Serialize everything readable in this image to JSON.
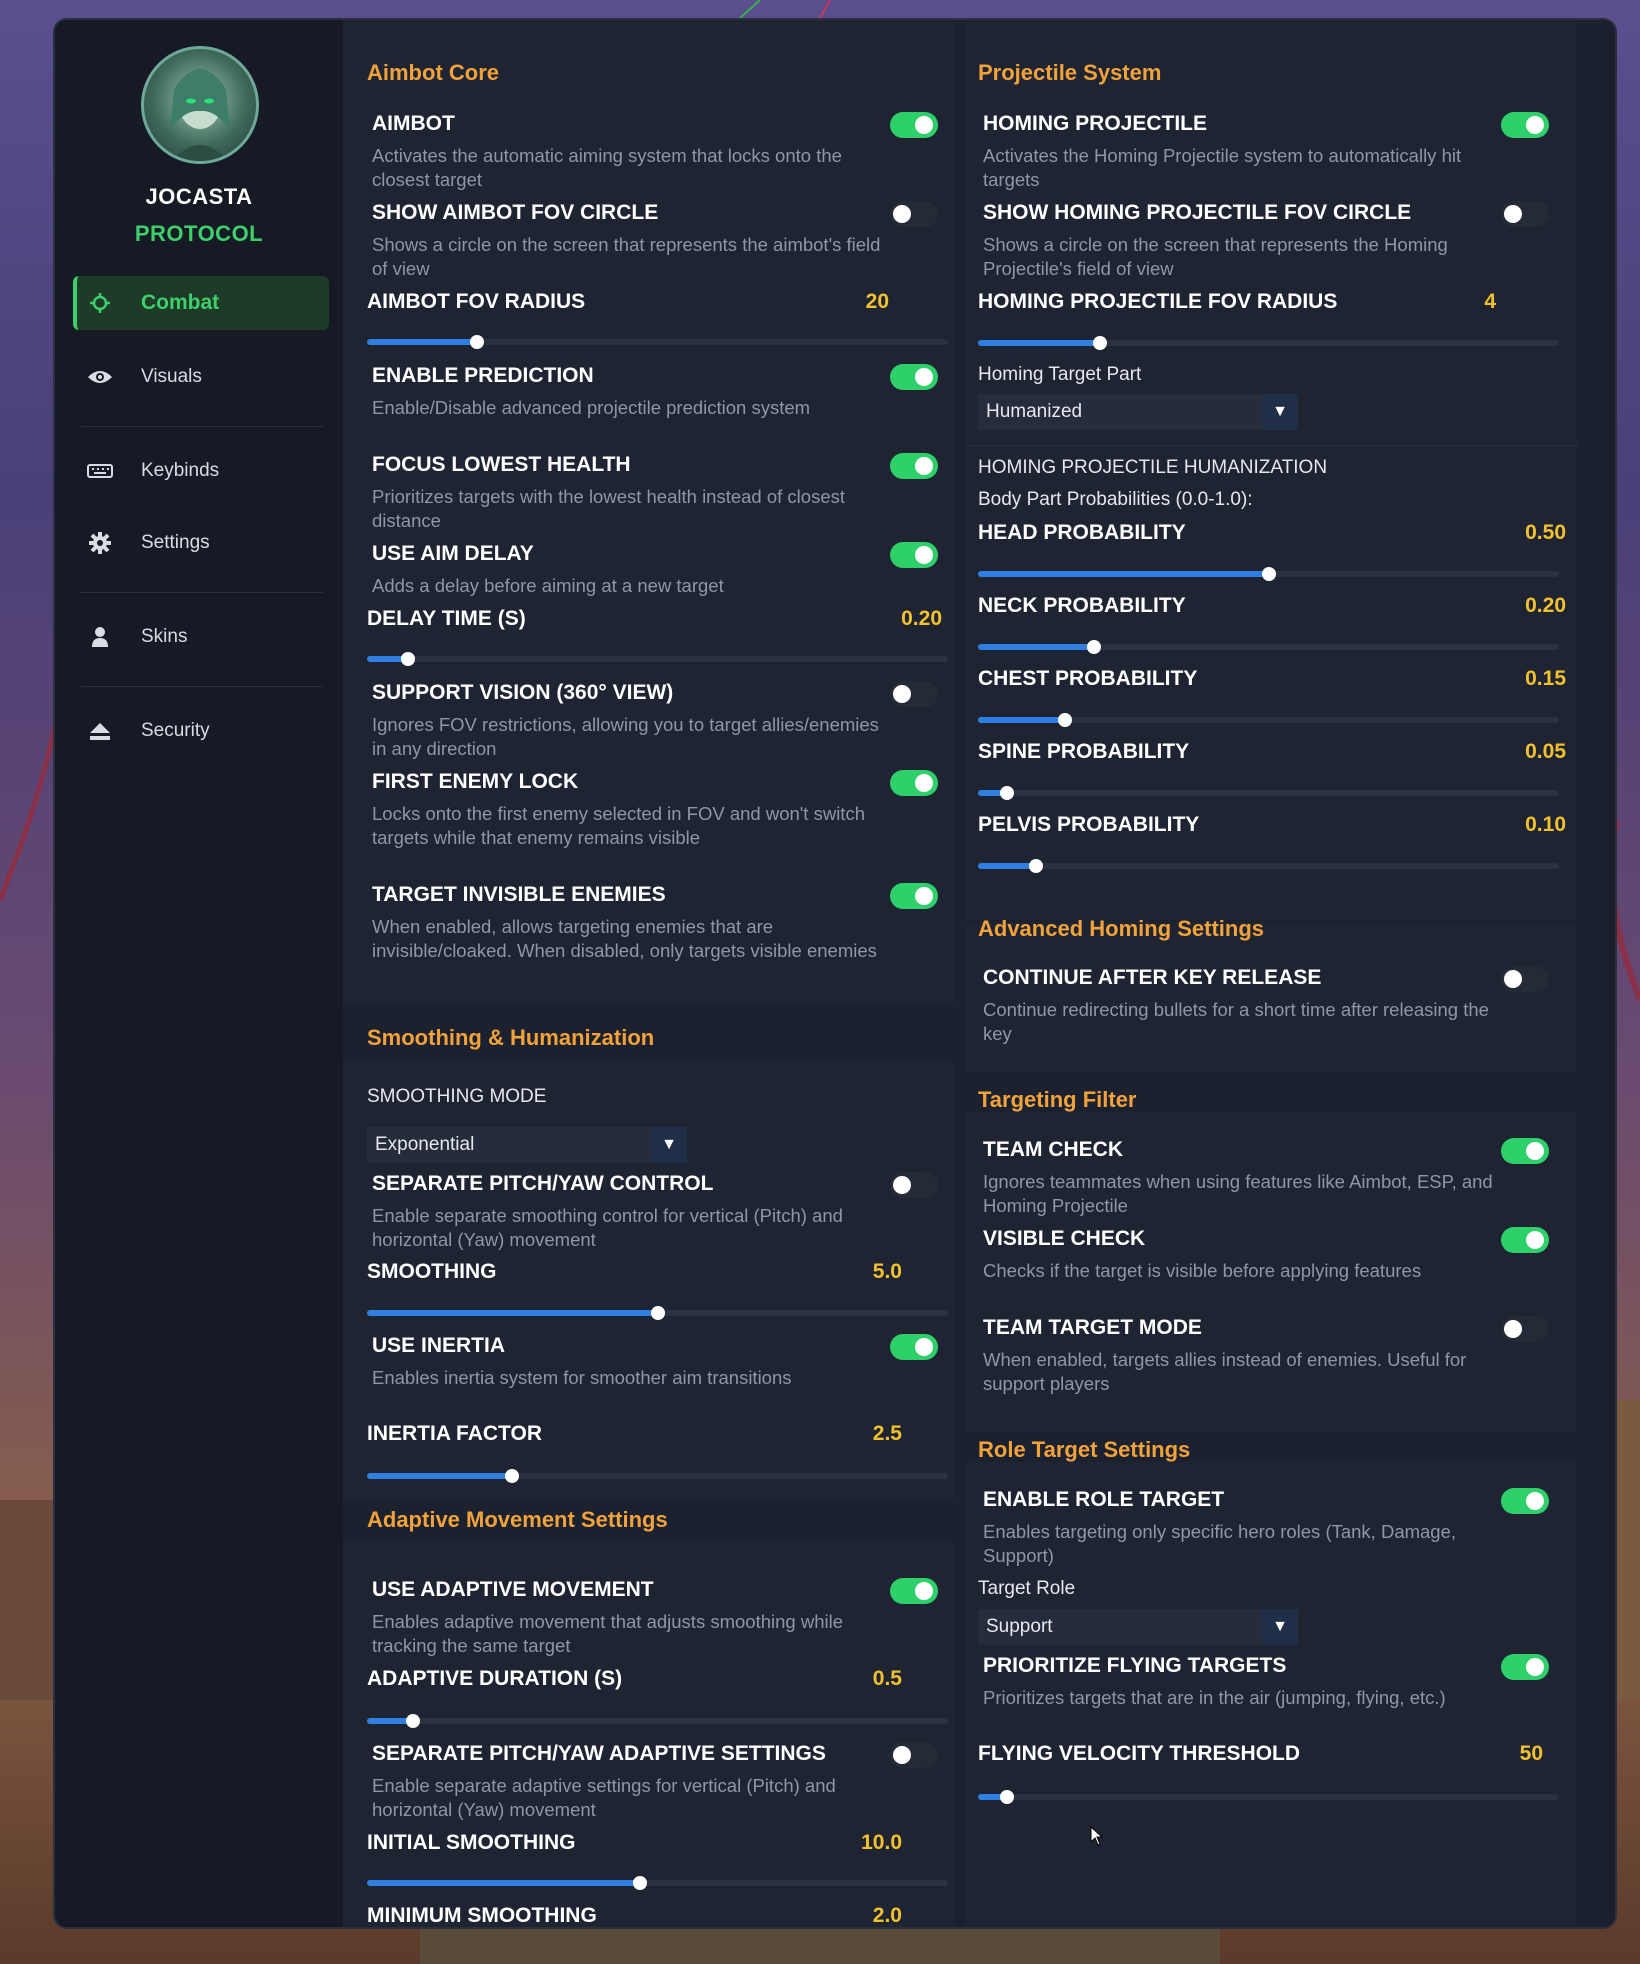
{
  "brand": {
    "line1": "JOCASTA",
    "line2": "PROTOCOL"
  },
  "nav": [
    {
      "label": "Combat",
      "icon": "crosshair-icon",
      "active": true
    },
    {
      "label": "Visuals",
      "icon": "eye-icon"
    },
    {
      "label": "Keybinds",
      "icon": "keyboard-icon"
    },
    {
      "label": "Settings",
      "icon": "gear-icon"
    },
    {
      "label": "Skins",
      "icon": "user-icon"
    },
    {
      "label": "Security",
      "icon": "eject-icon"
    }
  ],
  "colors": {
    "accent_green": "#2ed06a",
    "section_orange": "#f2a23a",
    "value_yellow": "#f2c12e",
    "slider_blue": "#2f7fe0"
  },
  "left": {
    "aimbot_core": {
      "title": "Aimbot Core",
      "aimbot": {
        "label": "AIMBOT",
        "desc": "Activates the automatic aiming system that locks onto the closest target",
        "on": true
      },
      "show_fov": {
        "label": "SHOW AIMBOT FOV CIRCLE",
        "desc": "Shows a circle on the screen that represents the aimbot's field of view",
        "on": false
      },
      "fov_radius": {
        "label": "AIMBOT FOV RADIUS",
        "value": "20",
        "fraction": 0.19
      },
      "prediction": {
        "label": "ENABLE PREDICTION",
        "desc": "Enable/Disable advanced projectile prediction system",
        "on": true
      },
      "lowest_health": {
        "label": "FOCUS LOWEST HEALTH",
        "desc": "Prioritizes targets with the lowest health instead of closest distance",
        "on": true
      },
      "aim_delay": {
        "label": "USE AIM DELAY",
        "desc": "Adds a delay before aiming at a new target",
        "on": true
      },
      "delay_time": {
        "label": "DELAY TIME (S)",
        "value": "0.20",
        "fraction": 0.07
      },
      "support_vision": {
        "label": "SUPPORT VISION (360° VIEW)",
        "desc": "Ignores FOV restrictions, allowing you to target allies/enemies in any direction",
        "on": false
      },
      "first_enemy": {
        "label": "FIRST ENEMY LOCK",
        "desc": "Locks onto the first enemy selected in FOV and won't switch targets while that enemy remains visible",
        "on": true
      },
      "invisible": {
        "label": "TARGET INVISIBLE ENEMIES",
        "desc": "When enabled, allows targeting enemies that are invisible/cloaked. When disabled, only targets visible enemies",
        "on": true
      }
    },
    "smoothing": {
      "title": "Smoothing & Humanization",
      "mode_label": "SMOOTHING MODE",
      "mode_value": "Exponential",
      "separate": {
        "label": "SEPARATE PITCH/YAW CONTROL",
        "desc": "Enable separate smoothing control for vertical (Pitch) and horizontal (Yaw) movement",
        "on": false
      },
      "smoothing": {
        "label": "SMOOTHING",
        "value": "5.0",
        "fraction": 0.5
      },
      "inertia": {
        "label": "USE INERTIA",
        "desc": "Enables inertia system for smoother aim transitions",
        "on": true
      },
      "inertia_factor": {
        "label": "INERTIA FACTOR",
        "value": "2.5",
        "fraction": 0.25
      }
    },
    "adaptive": {
      "title": "Adaptive Movement Settings",
      "use": {
        "label": "USE ADAPTIVE MOVEMENT",
        "desc": "Enables adaptive movement that adjusts smoothing while tracking the same target",
        "on": true
      },
      "duration": {
        "label": "ADAPTIVE DURATION (S)",
        "value": "0.5",
        "fraction": 0.08
      },
      "separate": {
        "label": "SEPARATE PITCH/YAW ADAPTIVE SETTINGS",
        "desc": "Enable separate adaptive settings for vertical (Pitch) and horizontal (Yaw) movement",
        "on": false
      },
      "initial": {
        "label": "INITIAL SMOOTHING",
        "value": "10.0",
        "fraction": 0.47
      },
      "minimum": {
        "label": "MINIMUM SMOOTHING",
        "value": "2.0"
      }
    }
  },
  "right": {
    "projectile": {
      "title": "Projectile System",
      "homing": {
        "label": "HOMING PROJECTILE",
        "desc": "Activates the Homing Projectile system to automatically hit targets",
        "on": true
      },
      "show_fov": {
        "label": "SHOW HOMING PROJECTILE FOV CIRCLE",
        "desc": "Shows a circle on the screen that represents the Homing Projectile's field of view",
        "on": false
      },
      "fov_radius": {
        "label": "HOMING PROJECTILE FOV RADIUS",
        "value": "4",
        "fraction": 0.21
      },
      "target_part_label": "Homing Target Part",
      "target_part_value": "Humanized",
      "humanization_label": "HOMING PROJECTILE HUMANIZATION",
      "probs_label": "Body Part Probabilities (0.0-1.0):",
      "head": {
        "label": "HEAD PROBABILITY",
        "value": "0.50",
        "fraction": 0.5
      },
      "neck": {
        "label": "NECK PROBABILITY",
        "value": "0.20",
        "fraction": 0.2
      },
      "chest": {
        "label": "CHEST PROBABILITY",
        "value": "0.15",
        "fraction": 0.15
      },
      "spine": {
        "label": "SPINE PROBABILITY",
        "value": "0.05",
        "fraction": 0.05
      },
      "pelvis": {
        "label": "PELVIS PROBABILITY",
        "value": "0.10",
        "fraction": 0.1
      }
    },
    "advanced": {
      "title": "Advanced Homing Settings",
      "continue": {
        "label": "CONTINUE AFTER KEY RELEASE",
        "desc": "Continue redirecting bullets for a short time after releasing the key",
        "on": false
      }
    },
    "filter": {
      "title": "Targeting Filter",
      "team": {
        "label": "TEAM CHECK",
        "desc": "Ignores teammates when using features like Aimbot, ESP, and Homing Projectile",
        "on": true
      },
      "visible": {
        "label": "VISIBLE CHECK",
        "desc": "Checks if the target is visible before applying features",
        "on": true
      },
      "team_target": {
        "label": "TEAM TARGET MODE",
        "desc": "When enabled, targets allies instead of enemies. Useful for support players",
        "on": false
      }
    },
    "role": {
      "title": "Role Target Settings",
      "enable": {
        "label": "ENABLE ROLE TARGET",
        "desc": "Enables targeting only specific hero roles (Tank, Damage, Support)",
        "on": true
      },
      "target_role_label": "Target Role",
      "target_role_value": "Support",
      "flying": {
        "label": "PRIORITIZE FLYING TARGETS",
        "desc": "Prioritizes targets that are in the air (jumping, flying, etc.)",
        "on": true
      },
      "velocity": {
        "label": "FLYING VELOCITY THRESHOLD",
        "value": "50",
        "fraction": 0.05
      }
    }
  }
}
